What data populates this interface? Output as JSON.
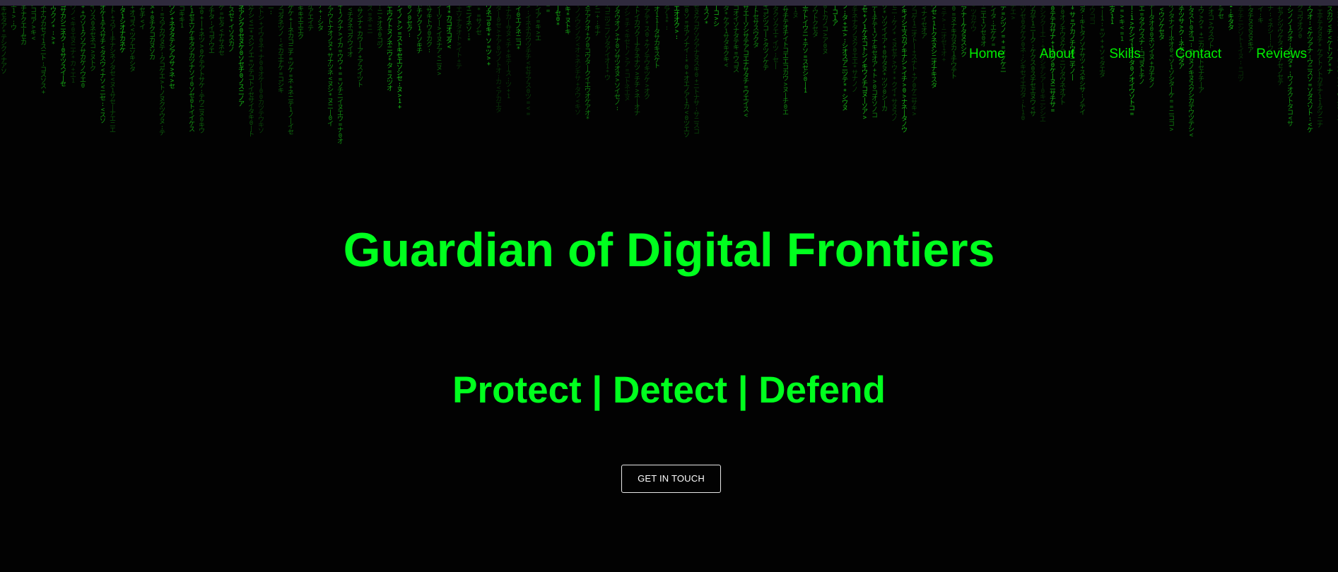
{
  "nav": {
    "items": [
      {
        "label": "Home"
      },
      {
        "label": "About"
      },
      {
        "label": "Skills"
      },
      {
        "label": "Contact"
      },
      {
        "label": "Reviews"
      }
    ]
  },
  "hero": {
    "title": "Guardian of Digital Frontiers",
    "subtitle": "Protect | Detect | Defend",
    "cta_label": "GET IN TOUCH"
  },
  "colors": {
    "background": "#020202",
    "accent": "#00ff1e",
    "rain": "#17c417",
    "button_border": "#e8e8e8"
  }
}
